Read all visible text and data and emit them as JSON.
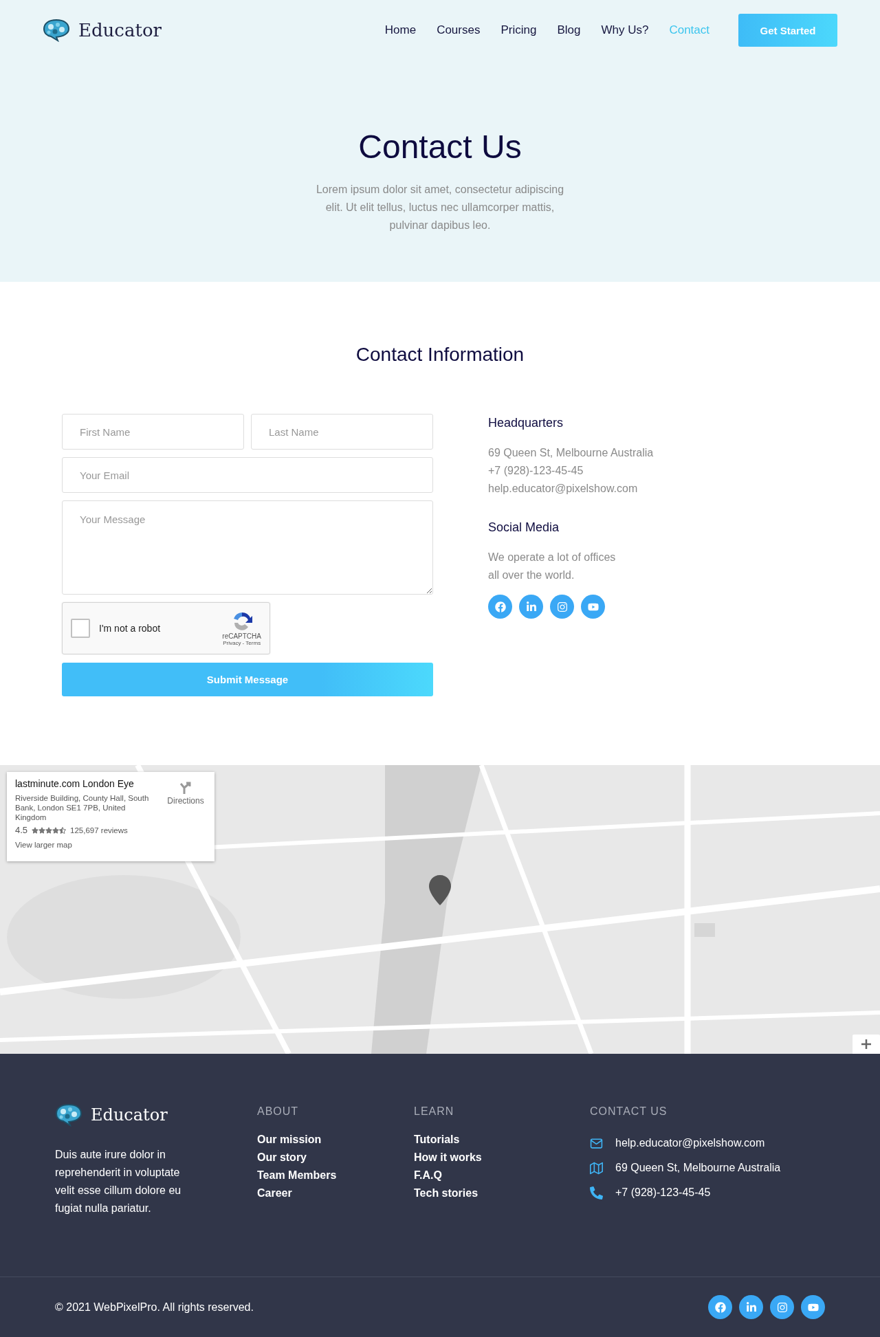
{
  "header": {
    "logo": "Educator",
    "nav": [
      {
        "label": "Home",
        "selected": false
      },
      {
        "label": "Courses",
        "selected": false
      },
      {
        "label": "Pricing",
        "selected": false
      },
      {
        "label": "Blog",
        "selected": false
      },
      {
        "label": "Why Us?",
        "selected": false
      },
      {
        "label": "Contact",
        "selected": true
      }
    ],
    "cta": "Get Started"
  },
  "hero": {
    "title": "Contact Us",
    "text": "Lorem ipsum dolor sit amet, consectetur adipiscing elit. Ut elit tellus, luctus nec ullamcorper mattis, pulvinar dapibus leo."
  },
  "contact": {
    "heading": "Contact Information",
    "form": {
      "fields": [
        {
          "kind": "half",
          "placeholder": "First Name"
        },
        {
          "kind": "half",
          "placeholder": "Last Name"
        },
        {
          "kind": "full",
          "placeholder": "Your Email"
        },
        {
          "kind": "textarea",
          "placeholder": "Your Message"
        }
      ],
      "captcha": {
        "label": "I'm not a robot",
        "checked": false,
        "brand": "reCAPTCHA",
        "links": "Privacy - Terms"
      },
      "submit": "Submit Message"
    },
    "info": [
      {
        "kind": "lines",
        "title": "Headquarters",
        "lines": [
          "69 Queen St, Melbourne Australia",
          "+7 (928)-123-45-45",
          "help.educator@pixelshow.com"
        ]
      },
      {
        "kind": "social",
        "title": "Social Media",
        "text": "We operate a lot of offices all over the world.",
        "icons": [
          {
            "kind": "facebook"
          },
          {
            "kind": "linkedin"
          },
          {
            "kind": "instagram"
          },
          {
            "kind": "youtube"
          }
        ]
      }
    ]
  },
  "map": {
    "card": {
      "title": "lastminute.com London Eye",
      "address": "Riverside Building, County Hall, South Bank, London SE1 7PB, United Kingdom",
      "rating": "4.5",
      "stars": 4.5,
      "reviews": "125,697 reviews",
      "link": "View larger map",
      "directions": "Directions"
    }
  },
  "footer": {
    "logo": "Educator",
    "blurb": "Duis aute irure dolor in reprehenderit in voluptate velit esse cillum dolore eu fugiat nulla pariatur.",
    "columns": [
      {
        "title": "ABOUT",
        "links": [
          "Our mission",
          "Our story",
          "Team Members",
          "Career"
        ]
      },
      {
        "title": "LEARN",
        "links": [
          "Tutorials",
          "How it works",
          "F.A.Q",
          "Tech stories"
        ]
      }
    ],
    "contact": {
      "title": "CONTACT US",
      "items": [
        {
          "kind": "mail",
          "text": "help.educator@pixelshow.com"
        },
        {
          "kind": "map",
          "text": "69 Queen St, Melbourne Australia"
        },
        {
          "kind": "phone",
          "text": "+7 (928)-123-45-45"
        }
      ]
    },
    "copyright": "© 2021 WebPixelPro. All rights reserved.",
    "socials": [
      {
        "kind": "facebook"
      },
      {
        "kind": "linkedin"
      },
      {
        "kind": "instagram"
      },
      {
        "kind": "youtube"
      }
    ]
  }
}
